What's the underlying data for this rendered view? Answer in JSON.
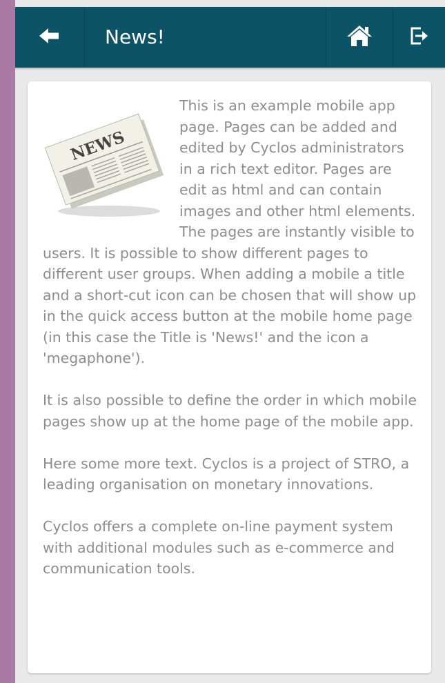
{
  "header": {
    "title": "News!",
    "back_icon": "arrow-left-icon",
    "home_icon": "home-icon",
    "logout_icon": "logout-icon"
  },
  "content": {
    "image_icon": "newspaper-icon",
    "image_text": "NEWS",
    "paragraphs": [
      "This is an example mobile app page. Pages can be added and edited by Cyclos administrators in a rich text editor. Pages are edit as html and can contain images and other html elements. The pages are instantly visible to users. It is possible to show different pages to different user groups. When adding a mobile a title and a short-cut icon can be chosen that will show up in the quick access button at the mobile home page (in this case the Title is 'News!' and the icon a 'megaphone').",
      "It is also possible to define the order in which mobile pages show up at the home page of the mobile app.",
      "Here some more text. Cyclos is a project of STRO, a leading organisation on monetary innovations.",
      "Cyclos offers a complete on-line payment system with additional modules such as e-commerce and communication tools."
    ]
  },
  "colors": {
    "header_bg": "#0d5366",
    "page_bg": "#e9e9ea",
    "outer_bg": "#a97aa6",
    "text": "#8d8d8d"
  }
}
